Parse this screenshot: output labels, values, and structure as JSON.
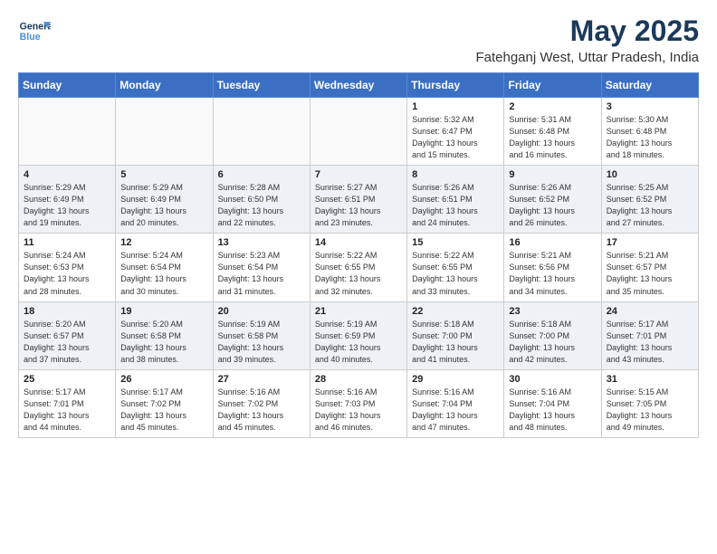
{
  "header": {
    "logo_line1": "General",
    "logo_line2": "Blue",
    "month_year": "May 2025",
    "location": "Fatehganj West, Uttar Pradesh, India"
  },
  "weekdays": [
    "Sunday",
    "Monday",
    "Tuesday",
    "Wednesday",
    "Thursday",
    "Friday",
    "Saturday"
  ],
  "weeks": [
    [
      {
        "day": "",
        "info": ""
      },
      {
        "day": "",
        "info": ""
      },
      {
        "day": "",
        "info": ""
      },
      {
        "day": "",
        "info": ""
      },
      {
        "day": "1",
        "info": "Sunrise: 5:32 AM\nSunset: 6:47 PM\nDaylight: 13 hours\nand 15 minutes."
      },
      {
        "day": "2",
        "info": "Sunrise: 5:31 AM\nSunset: 6:48 PM\nDaylight: 13 hours\nand 16 minutes."
      },
      {
        "day": "3",
        "info": "Sunrise: 5:30 AM\nSunset: 6:48 PM\nDaylight: 13 hours\nand 18 minutes."
      }
    ],
    [
      {
        "day": "4",
        "info": "Sunrise: 5:29 AM\nSunset: 6:49 PM\nDaylight: 13 hours\nand 19 minutes."
      },
      {
        "day": "5",
        "info": "Sunrise: 5:29 AM\nSunset: 6:49 PM\nDaylight: 13 hours\nand 20 minutes."
      },
      {
        "day": "6",
        "info": "Sunrise: 5:28 AM\nSunset: 6:50 PM\nDaylight: 13 hours\nand 22 minutes."
      },
      {
        "day": "7",
        "info": "Sunrise: 5:27 AM\nSunset: 6:51 PM\nDaylight: 13 hours\nand 23 minutes."
      },
      {
        "day": "8",
        "info": "Sunrise: 5:26 AM\nSunset: 6:51 PM\nDaylight: 13 hours\nand 24 minutes."
      },
      {
        "day": "9",
        "info": "Sunrise: 5:26 AM\nSunset: 6:52 PM\nDaylight: 13 hours\nand 26 minutes."
      },
      {
        "day": "10",
        "info": "Sunrise: 5:25 AM\nSunset: 6:52 PM\nDaylight: 13 hours\nand 27 minutes."
      }
    ],
    [
      {
        "day": "11",
        "info": "Sunrise: 5:24 AM\nSunset: 6:53 PM\nDaylight: 13 hours\nand 28 minutes."
      },
      {
        "day": "12",
        "info": "Sunrise: 5:24 AM\nSunset: 6:54 PM\nDaylight: 13 hours\nand 30 minutes."
      },
      {
        "day": "13",
        "info": "Sunrise: 5:23 AM\nSunset: 6:54 PM\nDaylight: 13 hours\nand 31 minutes."
      },
      {
        "day": "14",
        "info": "Sunrise: 5:22 AM\nSunset: 6:55 PM\nDaylight: 13 hours\nand 32 minutes."
      },
      {
        "day": "15",
        "info": "Sunrise: 5:22 AM\nSunset: 6:55 PM\nDaylight: 13 hours\nand 33 minutes."
      },
      {
        "day": "16",
        "info": "Sunrise: 5:21 AM\nSunset: 6:56 PM\nDaylight: 13 hours\nand 34 minutes."
      },
      {
        "day": "17",
        "info": "Sunrise: 5:21 AM\nSunset: 6:57 PM\nDaylight: 13 hours\nand 35 minutes."
      }
    ],
    [
      {
        "day": "18",
        "info": "Sunrise: 5:20 AM\nSunset: 6:57 PM\nDaylight: 13 hours\nand 37 minutes."
      },
      {
        "day": "19",
        "info": "Sunrise: 5:20 AM\nSunset: 6:58 PM\nDaylight: 13 hours\nand 38 minutes."
      },
      {
        "day": "20",
        "info": "Sunrise: 5:19 AM\nSunset: 6:58 PM\nDaylight: 13 hours\nand 39 minutes."
      },
      {
        "day": "21",
        "info": "Sunrise: 5:19 AM\nSunset: 6:59 PM\nDaylight: 13 hours\nand 40 minutes."
      },
      {
        "day": "22",
        "info": "Sunrise: 5:18 AM\nSunset: 7:00 PM\nDaylight: 13 hours\nand 41 minutes."
      },
      {
        "day": "23",
        "info": "Sunrise: 5:18 AM\nSunset: 7:00 PM\nDaylight: 13 hours\nand 42 minutes."
      },
      {
        "day": "24",
        "info": "Sunrise: 5:17 AM\nSunset: 7:01 PM\nDaylight: 13 hours\nand 43 minutes."
      }
    ],
    [
      {
        "day": "25",
        "info": "Sunrise: 5:17 AM\nSunset: 7:01 PM\nDaylight: 13 hours\nand 44 minutes."
      },
      {
        "day": "26",
        "info": "Sunrise: 5:17 AM\nSunset: 7:02 PM\nDaylight: 13 hours\nand 45 minutes."
      },
      {
        "day": "27",
        "info": "Sunrise: 5:16 AM\nSunset: 7:02 PM\nDaylight: 13 hours\nand 45 minutes."
      },
      {
        "day": "28",
        "info": "Sunrise: 5:16 AM\nSunset: 7:03 PM\nDaylight: 13 hours\nand 46 minutes."
      },
      {
        "day": "29",
        "info": "Sunrise: 5:16 AM\nSunset: 7:04 PM\nDaylight: 13 hours\nand 47 minutes."
      },
      {
        "day": "30",
        "info": "Sunrise: 5:16 AM\nSunset: 7:04 PM\nDaylight: 13 hours\nand 48 minutes."
      },
      {
        "day": "31",
        "info": "Sunrise: 5:15 AM\nSunset: 7:05 PM\nDaylight: 13 hours\nand 49 minutes."
      }
    ]
  ]
}
